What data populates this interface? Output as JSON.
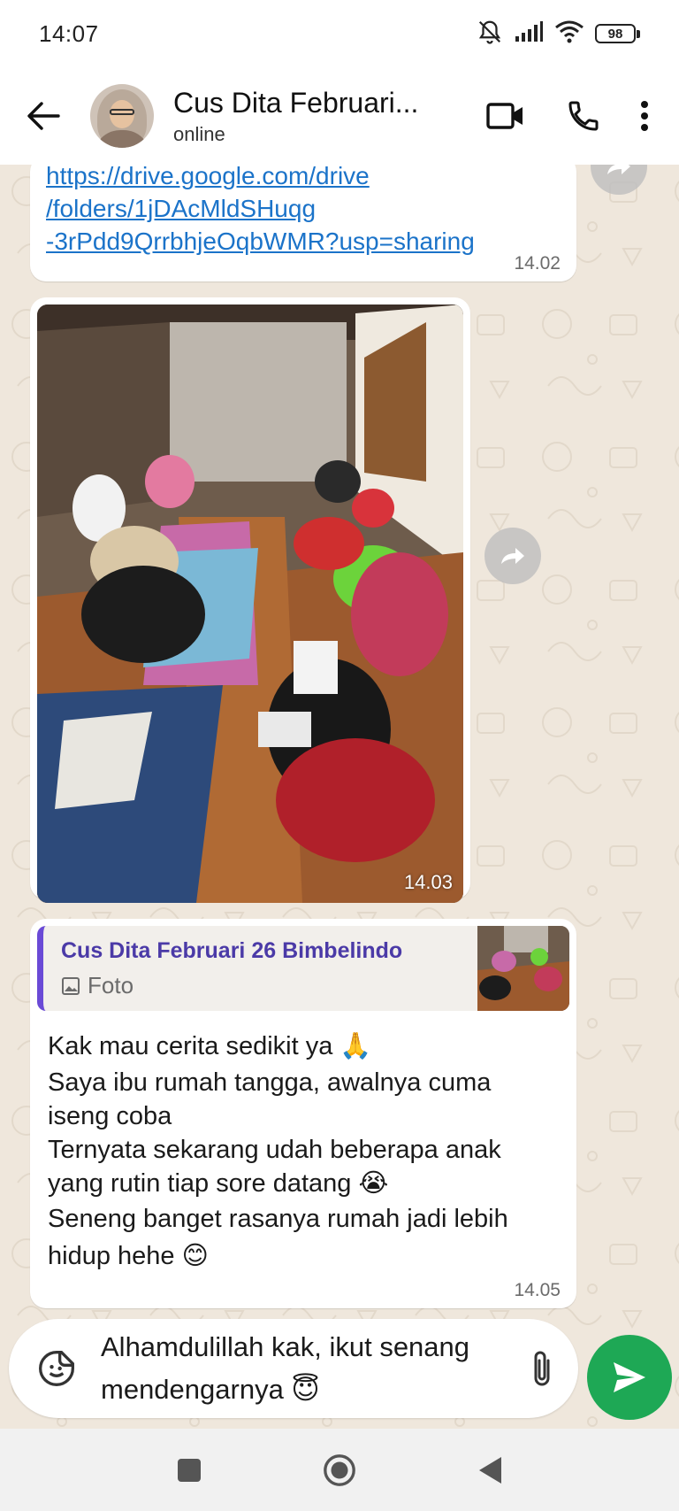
{
  "status_bar": {
    "time": "14:07",
    "battery": "98"
  },
  "header": {
    "contact_name": "Cus Dita Februari...",
    "status": "online"
  },
  "messages": {
    "link": {
      "lines": [
        "https://drive.google.com/drive",
        "/folders/1jDAcMldSHuqg",
        "-3rPdd9QrrbhjeOqbWMR?usp=sharing"
      ],
      "time": "14.02"
    },
    "photo": {
      "time": "14.03"
    },
    "reply": {
      "quoted_name": "Cus Dita Februari 26 Bimbelindo",
      "quoted_type": "Foto",
      "lines": [
        "Kak mau cerita sedikit ya 🙏",
        "Saya ibu rumah tangga, awalnya cuma iseng coba",
        "Ternyata sekarang udah beberapa anak yang rutin tiap sore datang 😭",
        "Seneng banget rasanya rumah jadi lebih hidup hehe 😊"
      ],
      "time": "14.05"
    }
  },
  "composer": {
    "text": "Alhamdulillah kak, ikut senang mendengarnya 😇"
  },
  "colors": {
    "accent": "#1ea855",
    "link": "#1b73c9",
    "quote_bar": "#6a4ad6",
    "chat_bg": "#efe7dc"
  }
}
